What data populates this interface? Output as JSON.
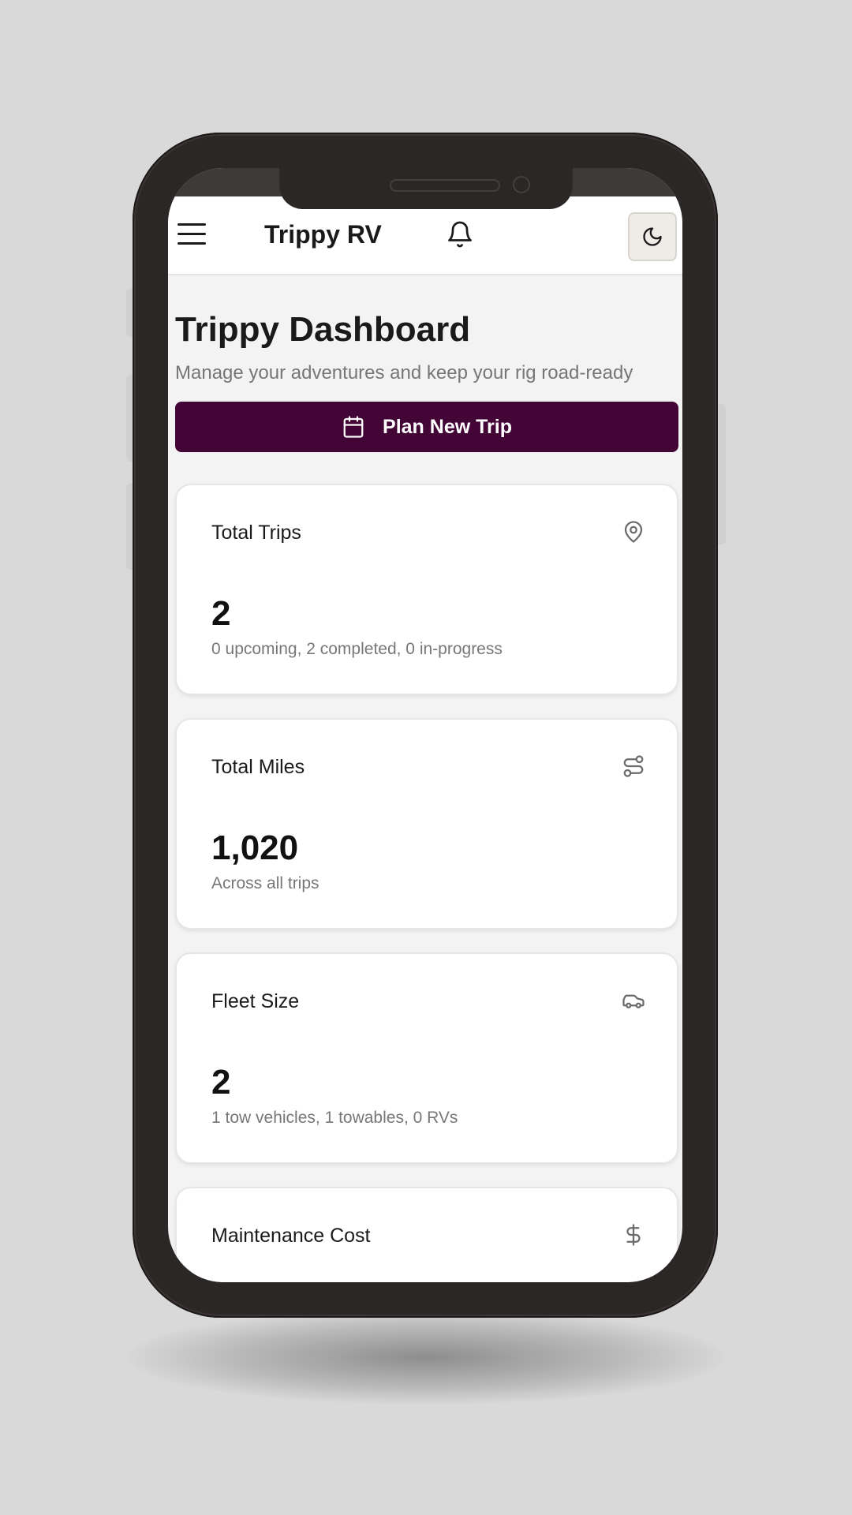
{
  "header": {
    "app_title": "Trippy RV"
  },
  "page": {
    "title": "Trippy Dashboard",
    "subtitle": "Manage your adventures and keep your rig road-ready",
    "plan_button_label": "Plan New Trip"
  },
  "cards": [
    {
      "title": "Total Trips",
      "icon": "map-pin-icon",
      "value": "2",
      "subtitle": "0 upcoming, 2 completed, 0 in-progress"
    },
    {
      "title": "Total Miles",
      "icon": "route-icon",
      "value": "1,020",
      "subtitle": "Across all trips"
    },
    {
      "title": "Fleet Size",
      "icon": "car-icon",
      "value": "2",
      "subtitle": "1 tow vehicles, 1 towables, 0 RVs"
    },
    {
      "title": "Maintenance Cost",
      "icon": "dollar-icon",
      "value": "",
      "subtitle": ""
    }
  ],
  "colors": {
    "accent": "#420536",
    "background": "#f3f3f3",
    "phone_frame": "#2b2726"
  }
}
